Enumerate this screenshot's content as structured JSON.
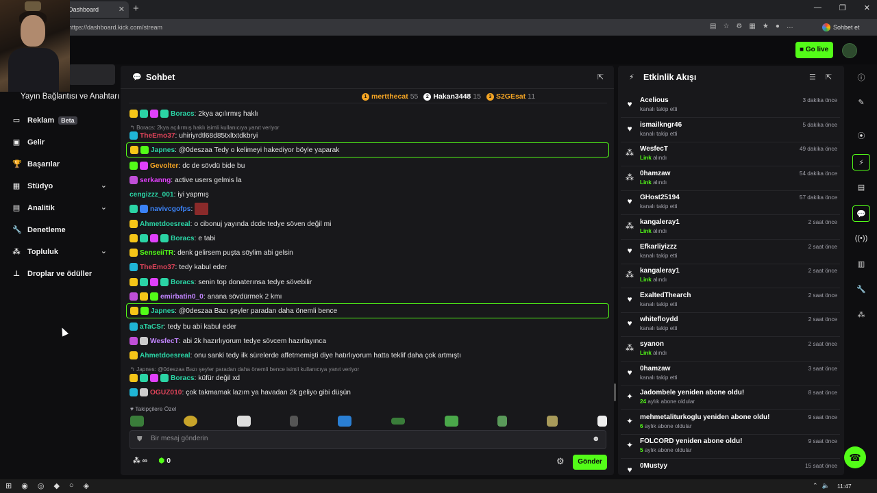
{
  "browser": {
    "tab_title": "Dashboard",
    "url": "https://dashboard.kick.com/stream",
    "profile_button": "Sohbet et"
  },
  "topbar": {
    "go_live": "Go live"
  },
  "sidebar": {
    "heading": "Yayın Bağlantısı ve Anahtarı",
    "items": [
      {
        "label": "Reklam",
        "badge": "Beta",
        "icon": "ad-icon"
      },
      {
        "label": "Gelir",
        "icon": "revenue-icon"
      },
      {
        "label": "Başarılar",
        "icon": "trophy-icon"
      },
      {
        "label": "Stüdyo",
        "icon": "studio-icon",
        "expandable": true
      },
      {
        "label": "Analitik",
        "icon": "analytics-icon",
        "expandable": true
      },
      {
        "label": "Denetleme",
        "icon": "wrench-icon"
      },
      {
        "label": "Topluluk",
        "icon": "community-icon",
        "expandable": true
      },
      {
        "label": "Droplar ve ödüller",
        "icon": "drops-icon"
      }
    ]
  },
  "chat": {
    "title": "Sohbet",
    "top_gifters": [
      {
        "name": "mertthecat",
        "count": "55",
        "color": "#f5a524",
        "medal": "1"
      },
      {
        "name": "Hakan3448",
        "count": "15",
        "color": "#ffffff",
        "medal": "2"
      },
      {
        "name": "S2GEsat",
        "count": "11",
        "color": "#f5a524",
        "medal": "3"
      }
    ],
    "messages": [
      {
        "user": "Boracs",
        "text": "2kya açılırmış haklı",
        "color": "#2bd4a5",
        "badges": [
          "#f5c518",
          "#2bd4a5",
          "#e040fb",
          "#2bd4a5"
        ]
      },
      {
        "reply": "Boracs: 2kya açılırmış haklı isimli kullanıcıya yanıt veriyor"
      },
      {
        "user": "TheEmo37",
        "text": "uhiriyrdtl68d85txltxtdkbryi",
        "color": "#e0445a",
        "badges": [
          "#1fb5d6"
        ]
      },
      {
        "user": "Japnes",
        "text": "@0deszaa Tedy o kelimeyi hakediyor böyle yaparak",
        "color": "#2bd4a5",
        "badges": [
          "#f5c518",
          "#53fc18"
        ],
        "highlight": true
      },
      {
        "user": "Gevolter",
        "text": "dc de sövdü bide bu",
        "color": "#f5a524",
        "badges": [
          "#53fc18",
          "#e040fb"
        ]
      },
      {
        "user": "serkanng",
        "text": "active users gelmis la",
        "color": "#e040fb",
        "badges": [
          "#c04fd8"
        ]
      },
      {
        "user": "cengizzz_001",
        "text": "iyi yapmış",
        "color": "#2bd4a5",
        "badges": []
      },
      {
        "user": "navivcgofps",
        "text": "",
        "color": "#3b82f6",
        "badges": [
          "#2bd4a5",
          "#3b82f6"
        ],
        "emote": true
      },
      {
        "user": "Ahmetdoesreal",
        "text": "o cibonuj yayında dcde tedye söven değil mi",
        "color": "#2bd4a5",
        "badges": [
          "#f5c518"
        ]
      },
      {
        "user": "Boracs",
        "text": "e tabi",
        "color": "#2bd4a5",
        "badges": [
          "#f5c518",
          "#2bd4a5",
          "#e040fb",
          "#2bd4a5"
        ]
      },
      {
        "user": "SenseiiTR",
        "text": "denk gelirsem puşta söylim abi gelsin",
        "color": "#53fc18",
        "badges": [
          "#f5c518"
        ]
      },
      {
        "user": "TheEmo37",
        "text": "tedy kabul eder",
        "color": "#e0445a",
        "badges": [
          "#1fb5d6"
        ]
      },
      {
        "user": "Boracs",
        "text": "senin top donaterınsa tedye sövebilir",
        "color": "#2bd4a5",
        "badges": [
          "#f5c518",
          "#2bd4a5",
          "#e040fb",
          "#2bd4a5"
        ]
      },
      {
        "user": "emirbatin0_0",
        "text": "anana sövdürmek 2 kmı",
        "color": "#c084fc",
        "badges": [
          "#c04fd8",
          "#f5c518",
          "#53fc18"
        ]
      },
      {
        "user": "Japnes",
        "text": "@0deszaa Bazı şeyler paradan daha önemli bence",
        "color": "#2bd4a5",
        "badges": [
          "#f5c518",
          "#53fc18"
        ],
        "highlight": true
      },
      {
        "user": "aTaCSr",
        "text": "tedy bu abi kabul eder",
        "color": "#2bd4a5",
        "badges": [
          "#1fb5d6"
        ]
      },
      {
        "user": "WesfecT",
        "text": "abi 2k hazırlıyorum tedye sövcem hazırlayınca",
        "color": "#c084fc",
        "badges": [
          "#c04fd8",
          "#cccccc"
        ]
      },
      {
        "user": "Ahmetdoesreal",
        "text": "onu sanki tedy ilk sürelerde affetmemişti diye hatırlıyorum hatta teklif daha çok artmıştı",
        "color": "#2bd4a5",
        "badges": [
          "#f5c518"
        ]
      },
      {
        "reply": "Japnes: @0deszaa Bazı şeyler paradan daha önemli bence isimli kullanıcıya yanıt veriyor"
      },
      {
        "user": "Boracs",
        "text": "küfür değil xd",
        "color": "#2bd4a5",
        "badges": [
          "#f5c518",
          "#2bd4a5",
          "#e040fb",
          "#2bd4a5"
        ]
      },
      {
        "user": "OGUZ010",
        "text": "çok takmamak lazım ya havadan 2k geliyo gibi düşün",
        "color": "#e0445a",
        "badges": [
          "#1fb5d6",
          "#cccccc"
        ]
      }
    ],
    "emote_section_label": "Takipçilere Özel",
    "input_placeholder": "Bir mesaj gönderin",
    "viewer_label": "∞",
    "points": "0",
    "send_label": "Gönder"
  },
  "activity": {
    "title": "Etkinlik Akışı",
    "items": [
      {
        "name": "Acelious",
        "sub": "kanalı takip etti",
        "time": "3 dakika önce",
        "kind": "follow"
      },
      {
        "name": "ismailkngr46",
        "sub": "kanalı takip etti",
        "time": "5 dakika önce",
        "kind": "follow"
      },
      {
        "name": "WesfecT",
        "sub_hl": "Link",
        "sub": "alındı",
        "time": "49 dakika önce",
        "kind": "link"
      },
      {
        "name": "0hamzaw",
        "sub_hl": "Link",
        "sub": "alındı",
        "time": "54 dakika önce",
        "kind": "link"
      },
      {
        "name": "GHost25194",
        "sub": "kanalı takip etti",
        "time": "57 dakika önce",
        "kind": "follow"
      },
      {
        "name": "kangaleray1",
        "sub_hl": "Link",
        "sub": "alındı",
        "time": "2 saat önce",
        "kind": "link"
      },
      {
        "name": "Efkarliyizzz",
        "sub": "kanalı takip etti",
        "time": "2 saat önce",
        "kind": "follow"
      },
      {
        "name": "kangaleray1",
        "sub_hl": "Link",
        "sub": "alındı",
        "time": "2 saat önce",
        "kind": "link"
      },
      {
        "name": "ExaltedThearch",
        "sub": "kanalı takip etti",
        "time": "2 saat önce",
        "kind": "follow"
      },
      {
        "name": "whitefloydd",
        "sub": "kanalı takip etti",
        "time": "2 saat önce",
        "kind": "follow"
      },
      {
        "name": "syanon",
        "sub_hl": "Link",
        "sub": "alındı",
        "time": "2 saat önce",
        "kind": "link"
      },
      {
        "name": "0hamzaw",
        "sub": "kanalı takip etti",
        "time": "3 saat önce",
        "kind": "follow"
      },
      {
        "name": "Jadombele yeniden abone oldu!",
        "sub_hl": "24",
        "sub": "aylık abone oldular",
        "time": "8 saat önce",
        "kind": "sub"
      },
      {
        "name": "mehmetaliturkoglu yeniden abone oldu!",
        "sub_hl": "6",
        "sub": "aylık abone oldular",
        "time": "9 saat önce",
        "kind": "sub"
      },
      {
        "name": "FOLCORD yeniden abone oldu!",
        "sub_hl": "5",
        "sub": "aylık abone oldular",
        "time": "9 saat önce",
        "kind": "sub"
      },
      {
        "name": "0Mustyy",
        "sub": "",
        "time": "15 saat önce",
        "kind": "follow"
      }
    ]
  },
  "taskbar": {
    "clock": "11:47"
  },
  "colors": {
    "accent": "#53fc18",
    "panel": "#18181b",
    "background": "#0e0e10"
  }
}
